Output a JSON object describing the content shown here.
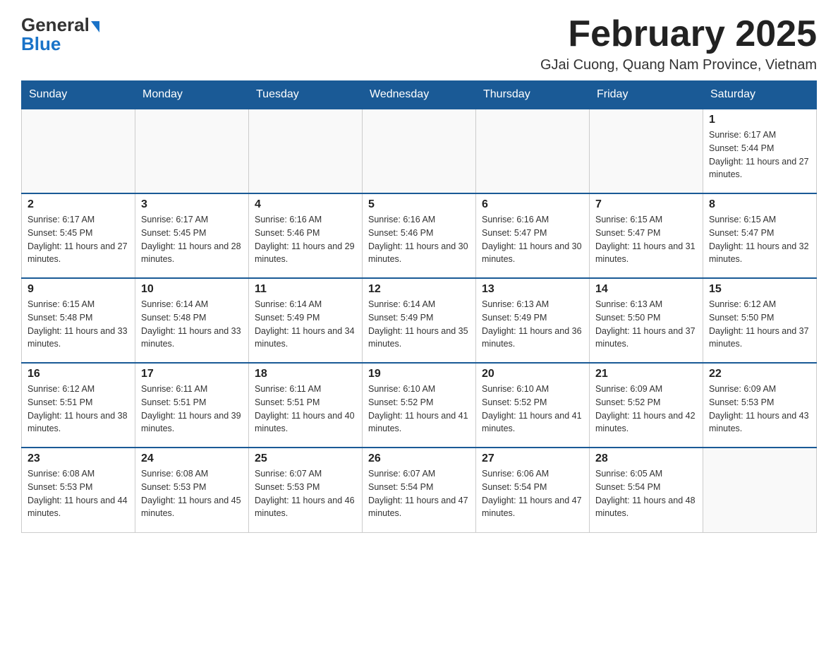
{
  "logo": {
    "general": "General",
    "blue": "Blue"
  },
  "title": "February 2025",
  "subtitle": "GJai Cuong, Quang Nam Province, Vietnam",
  "days_of_week": [
    "Sunday",
    "Monday",
    "Tuesday",
    "Wednesday",
    "Thursday",
    "Friday",
    "Saturday"
  ],
  "weeks": [
    [
      {
        "day": "",
        "info": ""
      },
      {
        "day": "",
        "info": ""
      },
      {
        "day": "",
        "info": ""
      },
      {
        "day": "",
        "info": ""
      },
      {
        "day": "",
        "info": ""
      },
      {
        "day": "",
        "info": ""
      },
      {
        "day": "1",
        "info": "Sunrise: 6:17 AM\nSunset: 5:44 PM\nDaylight: 11 hours and 27 minutes."
      }
    ],
    [
      {
        "day": "2",
        "info": "Sunrise: 6:17 AM\nSunset: 5:45 PM\nDaylight: 11 hours and 27 minutes."
      },
      {
        "day": "3",
        "info": "Sunrise: 6:17 AM\nSunset: 5:45 PM\nDaylight: 11 hours and 28 minutes."
      },
      {
        "day": "4",
        "info": "Sunrise: 6:16 AM\nSunset: 5:46 PM\nDaylight: 11 hours and 29 minutes."
      },
      {
        "day": "5",
        "info": "Sunrise: 6:16 AM\nSunset: 5:46 PM\nDaylight: 11 hours and 30 minutes."
      },
      {
        "day": "6",
        "info": "Sunrise: 6:16 AM\nSunset: 5:47 PM\nDaylight: 11 hours and 30 minutes."
      },
      {
        "day": "7",
        "info": "Sunrise: 6:15 AM\nSunset: 5:47 PM\nDaylight: 11 hours and 31 minutes."
      },
      {
        "day": "8",
        "info": "Sunrise: 6:15 AM\nSunset: 5:47 PM\nDaylight: 11 hours and 32 minutes."
      }
    ],
    [
      {
        "day": "9",
        "info": "Sunrise: 6:15 AM\nSunset: 5:48 PM\nDaylight: 11 hours and 33 minutes."
      },
      {
        "day": "10",
        "info": "Sunrise: 6:14 AM\nSunset: 5:48 PM\nDaylight: 11 hours and 33 minutes."
      },
      {
        "day": "11",
        "info": "Sunrise: 6:14 AM\nSunset: 5:49 PM\nDaylight: 11 hours and 34 minutes."
      },
      {
        "day": "12",
        "info": "Sunrise: 6:14 AM\nSunset: 5:49 PM\nDaylight: 11 hours and 35 minutes."
      },
      {
        "day": "13",
        "info": "Sunrise: 6:13 AM\nSunset: 5:49 PM\nDaylight: 11 hours and 36 minutes."
      },
      {
        "day": "14",
        "info": "Sunrise: 6:13 AM\nSunset: 5:50 PM\nDaylight: 11 hours and 37 minutes."
      },
      {
        "day": "15",
        "info": "Sunrise: 6:12 AM\nSunset: 5:50 PM\nDaylight: 11 hours and 37 minutes."
      }
    ],
    [
      {
        "day": "16",
        "info": "Sunrise: 6:12 AM\nSunset: 5:51 PM\nDaylight: 11 hours and 38 minutes."
      },
      {
        "day": "17",
        "info": "Sunrise: 6:11 AM\nSunset: 5:51 PM\nDaylight: 11 hours and 39 minutes."
      },
      {
        "day": "18",
        "info": "Sunrise: 6:11 AM\nSunset: 5:51 PM\nDaylight: 11 hours and 40 minutes."
      },
      {
        "day": "19",
        "info": "Sunrise: 6:10 AM\nSunset: 5:52 PM\nDaylight: 11 hours and 41 minutes."
      },
      {
        "day": "20",
        "info": "Sunrise: 6:10 AM\nSunset: 5:52 PM\nDaylight: 11 hours and 41 minutes."
      },
      {
        "day": "21",
        "info": "Sunrise: 6:09 AM\nSunset: 5:52 PM\nDaylight: 11 hours and 42 minutes."
      },
      {
        "day": "22",
        "info": "Sunrise: 6:09 AM\nSunset: 5:53 PM\nDaylight: 11 hours and 43 minutes."
      }
    ],
    [
      {
        "day": "23",
        "info": "Sunrise: 6:08 AM\nSunset: 5:53 PM\nDaylight: 11 hours and 44 minutes."
      },
      {
        "day": "24",
        "info": "Sunrise: 6:08 AM\nSunset: 5:53 PM\nDaylight: 11 hours and 45 minutes."
      },
      {
        "day": "25",
        "info": "Sunrise: 6:07 AM\nSunset: 5:53 PM\nDaylight: 11 hours and 46 minutes."
      },
      {
        "day": "26",
        "info": "Sunrise: 6:07 AM\nSunset: 5:54 PM\nDaylight: 11 hours and 47 minutes."
      },
      {
        "day": "27",
        "info": "Sunrise: 6:06 AM\nSunset: 5:54 PM\nDaylight: 11 hours and 47 minutes."
      },
      {
        "day": "28",
        "info": "Sunrise: 6:05 AM\nSunset: 5:54 PM\nDaylight: 11 hours and 48 minutes."
      },
      {
        "day": "",
        "info": ""
      }
    ]
  ]
}
